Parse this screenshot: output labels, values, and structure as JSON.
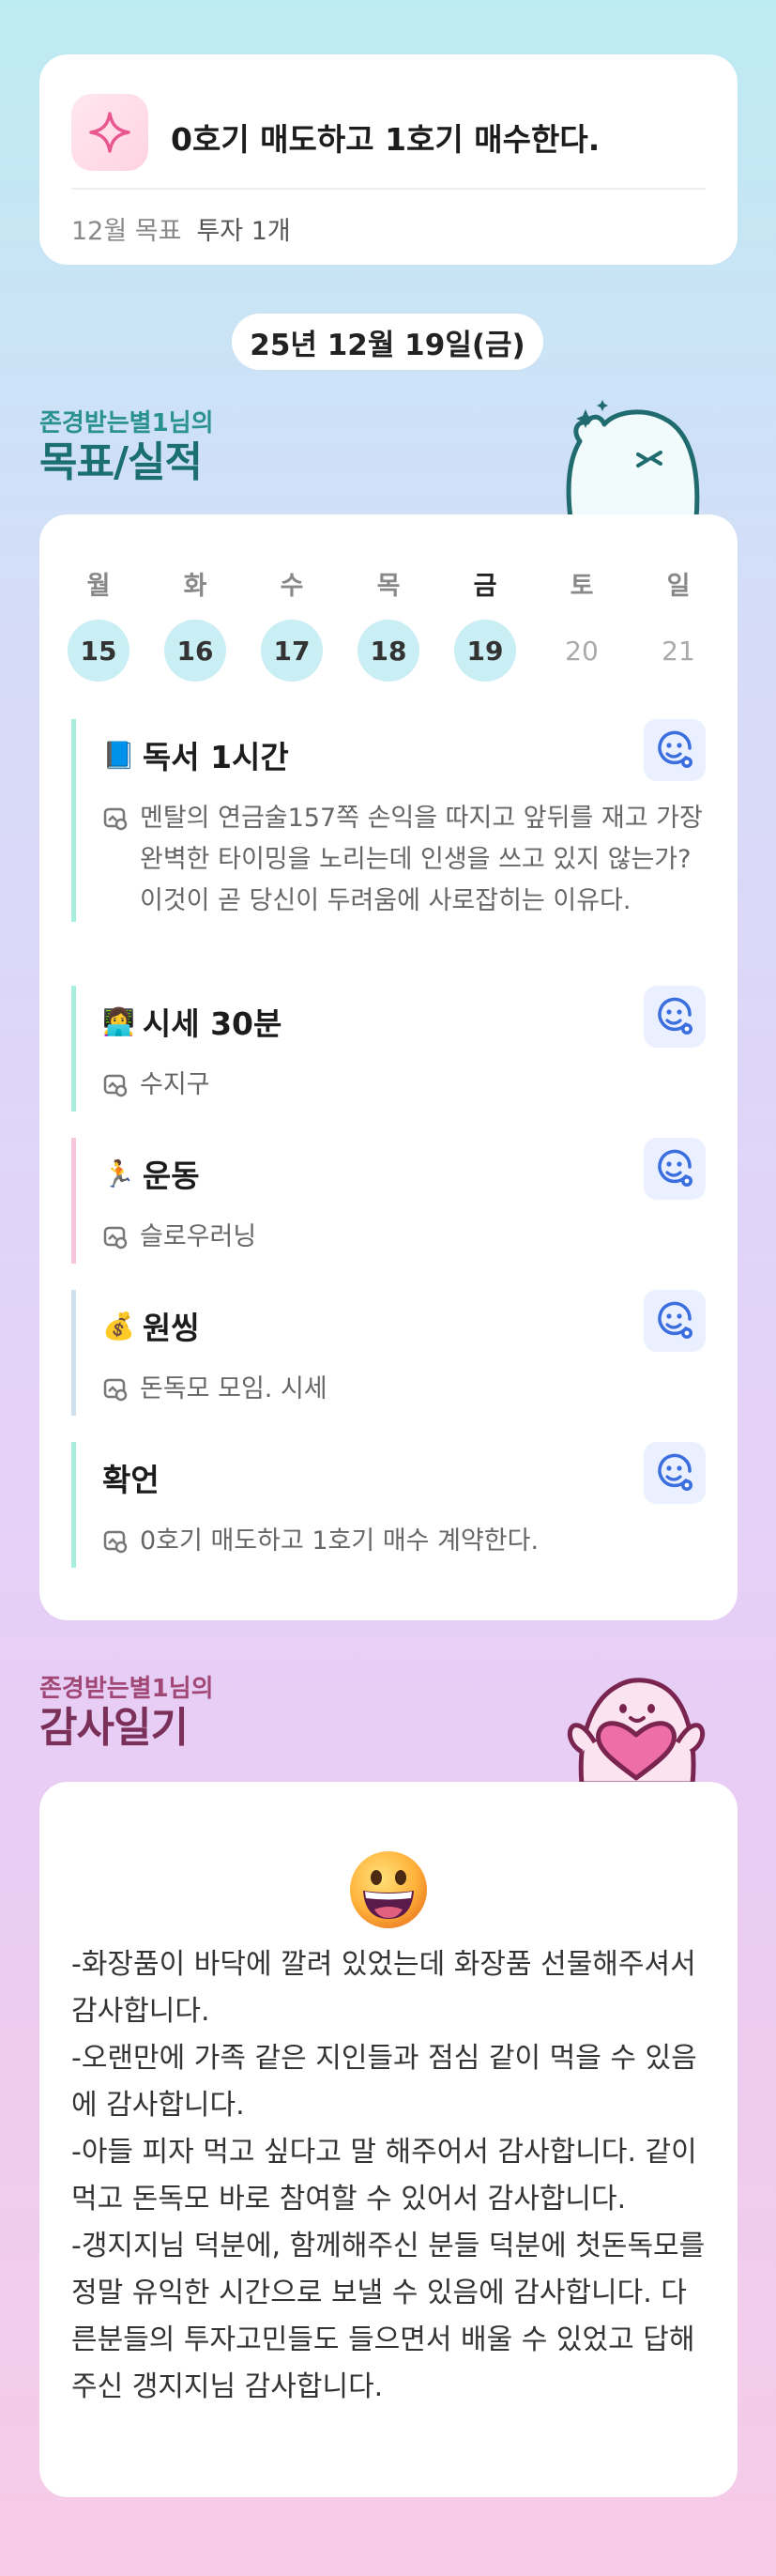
{
  "goal": {
    "title": "0호기 매도하고 1호기 매수한다.",
    "month_label": "12월 목표",
    "summary": "투자 1개",
    "icon": "sparkle-icon"
  },
  "date_label": "25년 12월 19일(금)",
  "goals_section": {
    "subtitle": "존경받는별1님의",
    "title": "목표/실적"
  },
  "week": {
    "days": [
      {
        "name": "월",
        "num": "15"
      },
      {
        "name": "화",
        "num": "16"
      },
      {
        "name": "수",
        "num": "17"
      },
      {
        "name": "목",
        "num": "18"
      },
      {
        "name": "금",
        "num": "19"
      },
      {
        "name": "토",
        "num": "20"
      },
      {
        "name": "일",
        "num": "21"
      }
    ]
  },
  "tasks": [
    {
      "emoji": "📘",
      "title": "독서 1시간",
      "desc": "멘탈의 연금술157쪽 손익을 따지고 앞뒤를 재고 가장 완벽한 타이밍을 노리는데 인생을 쓰고 있지 않는가? 이것이 곧 당신이 두려움에 사로잡히는 이유다.",
      "color": "#a8eedd"
    },
    {
      "emoji": "👩‍💻",
      "title": "시세 30분",
      "desc": "수지구",
      "color": "#a8eedd"
    },
    {
      "emoji": "🏃",
      "title": "운동",
      "desc": "슬로우러닝",
      "color": "#f7c6dd"
    },
    {
      "emoji": "💰",
      "title": "원씽",
      "desc": "돈독모 모임. 시세",
      "color": "#cfe1ef"
    },
    {
      "emoji": "",
      "title": "확언",
      "desc": "0호기 매도하고 1호기 매수 계약한다.",
      "color": "#a8eedd"
    }
  ],
  "gratitude_section": {
    "subtitle": "존경받는별1님의",
    "title": "감사일기"
  },
  "gratitude": {
    "emoji": "grinning-face-icon",
    "text": "-화장품이 바닥에 깔려 있었는데 화장품 선물해주셔서 감사합니다.\n-오랜만에 가족 같은 지인들과 점심 같이 먹을 수 있음에 감사합니다.\n-아들 피자 먹고 싶다고 말 해주어서 감사합니다. 같이 먹고 돈독모 바로 참여할 수 있어서 감사합니다.\n-갱지지님 덕분에, 함께해주신 분들 덕분에 첫돈독모를 정말 유익한 시간으로 보낼 수 있음에 감사합니다. 다른분들의 투자고민들도 들으면서 배울 수 있었고 답해주신 갱지지님 감사합니다."
  }
}
